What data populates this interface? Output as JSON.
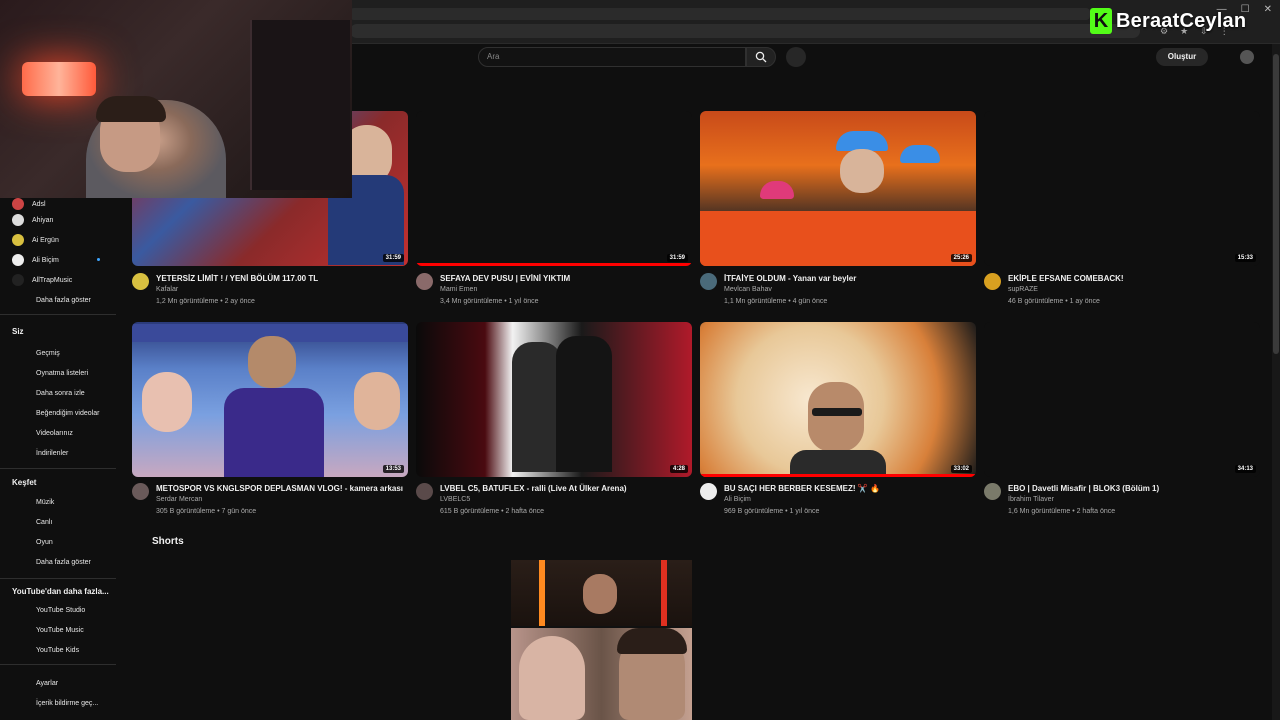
{
  "brand": {
    "letter": "K",
    "name": "BeraatCeylan"
  },
  "topbar": {
    "search_placeholder": "Ara",
    "create_label": "Oluştur"
  },
  "sidebar": {
    "subs": [
      {
        "label": "Adsl"
      },
      {
        "label": "Ahiyan"
      },
      {
        "label": "Ai Ergün"
      },
      {
        "label": "Ali Biçim"
      },
      {
        "label": "AllTrapMusic"
      },
      {
        "label": "Daha fazla göster"
      }
    ],
    "you_heading": "Siz",
    "you_items": [
      {
        "label": "Geçmiş"
      },
      {
        "label": "Oynatma listeleri"
      },
      {
        "label": "Daha sonra izle"
      },
      {
        "label": "Beğendiğim videolar"
      },
      {
        "label": "Videolarınız"
      },
      {
        "label": "İndirilenler"
      }
    ],
    "explore_heading": "Keşfet",
    "explore_items": [
      {
        "label": "Müzik"
      },
      {
        "label": "Canlı"
      },
      {
        "label": "Oyun"
      },
      {
        "label": "Daha fazla göster"
      }
    ],
    "more_heading": "YouTube'dan daha fazla...",
    "more_items": [
      {
        "label": "YouTube Studio"
      },
      {
        "label": "YouTube Music"
      },
      {
        "label": "YouTube Kids"
      }
    ],
    "bottom_items": [
      {
        "label": "Ayarlar"
      },
      {
        "label": "İçerik bildirme geç..."
      }
    ]
  },
  "videos": [
    {
      "title": "YETERSİZ LİMİT ! / YENİ BÖLÜM 117.00 TL",
      "channel": "Kafalar",
      "meta": "1,2 Mn görüntüleme • 2 ay önce",
      "duration": "31:59"
    },
    {
      "title": "SEFAYA DEV PUSU | EVİNİ YIKTIM",
      "channel": "Mami Emen",
      "meta": "3,4 Mn görüntüleme • 1 yıl önce",
      "duration": "31:59"
    },
    {
      "title": "İTFAİYE OLDUM - Yanan var beyler",
      "channel": "Mevlcan Bahav",
      "meta": "1,1 Mn görüntüleme • 4 gün önce",
      "duration": "25:26"
    },
    {
      "title": "EKİPLE EFSANE COMEBACK!",
      "channel": "supRAZE",
      "meta": "46 B görüntüleme • 1 ay önce",
      "duration": "15:33"
    },
    {
      "title": "METOSPOR VS KNGLSPOR DEPLASMAN VLOG! - kamera arkası",
      "channel": "Serdar Mercan",
      "meta": "305 B görüntüleme • 7 gün önce",
      "duration": "13:53"
    },
    {
      "title": "LVBEL C5, BATUFLEX - ralli (Live At Ülker Arena)",
      "channel": "LVBELC5",
      "meta": "615 B görüntüleme • 2 hafta önce",
      "duration": "4:28"
    },
    {
      "title": "BU SAÇI HER BERBER KESEMEZ! ✂️ 🔥",
      "channel": "Ali Biçim",
      "meta": "969 B görüntüleme • 1 yıl önce",
      "duration": "33:02"
    },
    {
      "title": "EBO | Davetli Misafir | BLOK3 (Bölüm 1)",
      "channel": "İbrahim Tilaver",
      "meta": "1,6 Mn görüntüleme • 2 hafta önce",
      "duration": "34:13"
    }
  ],
  "shorts_heading": "Shorts"
}
